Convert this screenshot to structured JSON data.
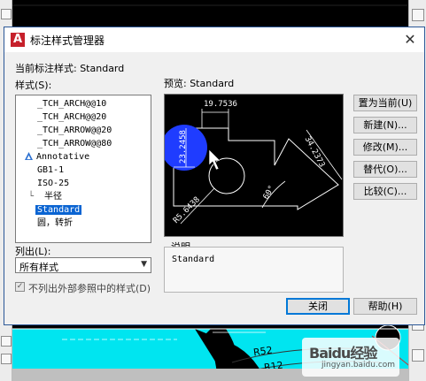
{
  "dialog": {
    "title": "标注样式管理器",
    "current_style_label": "当前标注样式: Standard",
    "styles_label": "样式(S):",
    "styles": [
      {
        "label": "_TCH_ARCH@@10",
        "selected": false,
        "annotative": false
      },
      {
        "label": "_TCH_ARCH@@20",
        "selected": false,
        "annotative": false
      },
      {
        "label": "_TCH_ARROW@@20",
        "selected": false,
        "annotative": false
      },
      {
        "label": "_TCH_ARROW@@80",
        "selected": false,
        "annotative": false
      },
      {
        "label": "Annotative",
        "selected": false,
        "annotative": true
      },
      {
        "label": "GB1-1",
        "selected": false,
        "annotative": false
      },
      {
        "label": "ISO-25",
        "selected": false,
        "annotative": false
      },
      {
        "label": "半径",
        "selected": false,
        "annotative": false,
        "child": true
      },
      {
        "label": "Standard",
        "selected": true,
        "annotative": false
      },
      {
        "label": "圆，转折",
        "selected": false,
        "annotative": false
      }
    ],
    "list_label": "列出(L):",
    "list_value": "所有样式",
    "checkbox_label": "不列出外部参照中的样式(D)",
    "preview_label": "预览: Standard",
    "preview_dims": {
      "top": "19.7536",
      "left": "23.2458",
      "right": "34.2373",
      "angle": "60°",
      "radius": "R5.6438"
    },
    "description_label": "说明",
    "description_value": "Standard",
    "buttons": {
      "set_current": "置为当前(U)",
      "new": "新建(N)...",
      "modify": "修改(M)...",
      "override": "替代(O)...",
      "compare": "比较(C)...",
      "close": "关闭",
      "help": "帮助(H)"
    }
  },
  "cad": {
    "label_r52": "R52",
    "label_r12": "R12"
  },
  "watermark": {
    "line1": "Baidu经验",
    "line2": "jingyan.baidu.com"
  },
  "colors": {
    "cad_cyan": "#00e5f0",
    "highlight_blue": "#1f3cff",
    "selection_blue": "#0a64d2",
    "dialog_bg": "#f0f0f0"
  }
}
